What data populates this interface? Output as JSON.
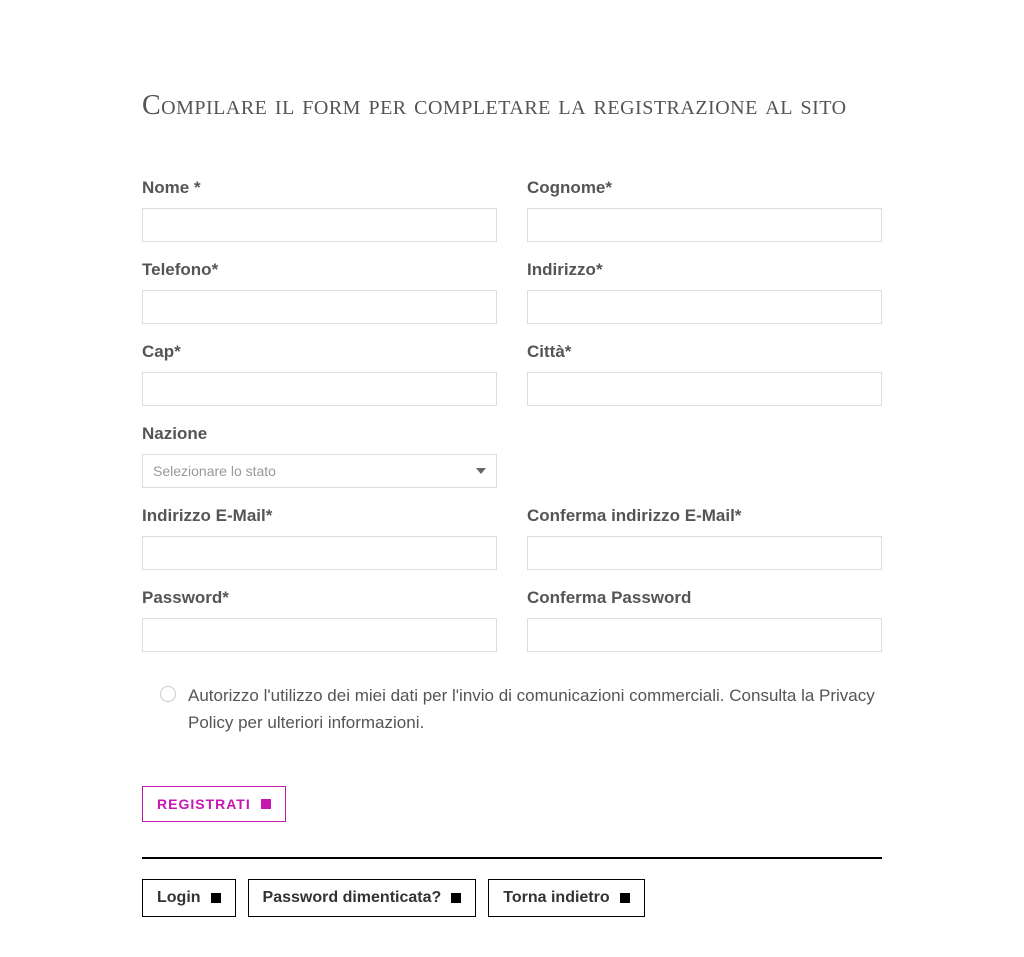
{
  "title": "Compilare il form per completare la registrazione al sito",
  "fields": {
    "nome": {
      "label": "Nome *",
      "value": ""
    },
    "cognome": {
      "label": "Cognome*",
      "value": ""
    },
    "telefono": {
      "label": "Telefono*",
      "value": ""
    },
    "indirizzo": {
      "label": "Indirizzo*",
      "value": ""
    },
    "cap": {
      "label": "Cap*",
      "value": ""
    },
    "citta": {
      "label": "Città*",
      "value": ""
    },
    "nazione": {
      "label": "Nazione",
      "placeholder": "Selezionare lo stato"
    },
    "email": {
      "label": "Indirizzo E-Mail*",
      "value": ""
    },
    "email_confirm": {
      "label": "Conferma indirizzo E-Mail*",
      "value": ""
    },
    "password": {
      "label": "Password*",
      "value": ""
    },
    "password_confirm": {
      "label": "Conferma Password",
      "value": ""
    }
  },
  "consent": {
    "text": "Autorizzo l'utilizzo dei miei dati per l'invio di comunicazioni commerciali. Consulta la Privacy Policy per ulteriori informazioni."
  },
  "buttons": {
    "submit": "REGISTRATI",
    "login": "Login",
    "forgot": "Password dimenticata?",
    "back": "Torna indietro"
  }
}
